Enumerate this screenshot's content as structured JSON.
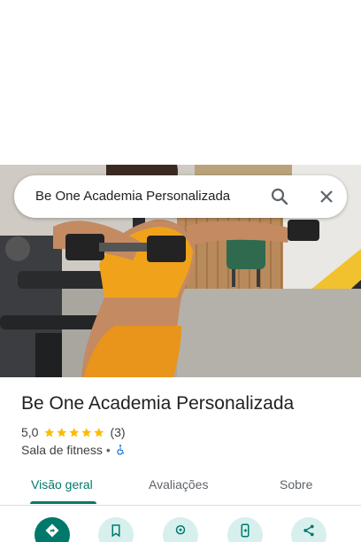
{
  "search": {
    "query": "Be One Academia Personalizada",
    "search_icon": "search-icon",
    "close_icon": "close-icon"
  },
  "hero": {
    "image": "gym-photo-woman-lifting-dumbbells"
  },
  "place": {
    "name": "Be One Academia Personalizada",
    "rating": "5,0",
    "stars": 5,
    "review_count": "(3)",
    "category": "Sala de fitness",
    "separator": "•",
    "accessibility_icon": "wheelchair-icon"
  },
  "tabs": [
    {
      "label": "Visão geral",
      "active": true
    },
    {
      "label": "Avaliações",
      "active": false
    },
    {
      "label": "Sobre",
      "active": false
    }
  ],
  "actions": [
    {
      "icon": "directions-icon",
      "primary": true
    },
    {
      "icon": "bookmark-icon",
      "primary": false
    },
    {
      "icon": "nearby-icon",
      "primary": false
    },
    {
      "icon": "send-to-phone-icon",
      "primary": false
    },
    {
      "icon": "share-icon",
      "primary": false
    }
  ],
  "colors": {
    "accent": "#00796b",
    "action_bg": "#d7f0ee",
    "star": "#fbbc04",
    "access_icon": "#1a73e8"
  }
}
